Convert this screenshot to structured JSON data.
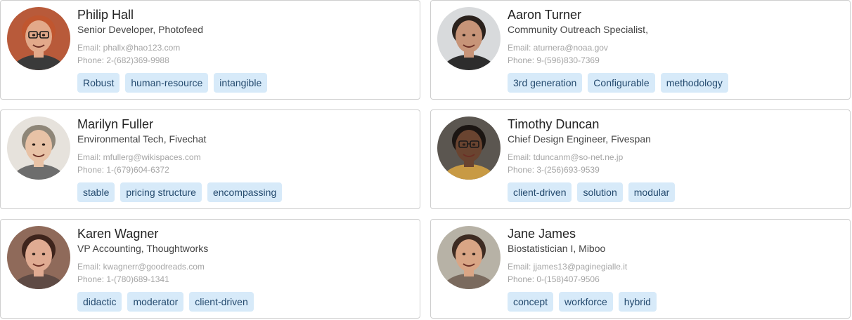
{
  "cards": [
    {
      "name": "Philip Hall",
      "title": "Senior Developer, Photofeed",
      "email": "Email: phallx@hao123.com",
      "phone": "Phone: 2-(682)369-9988",
      "tags": [
        "Robust",
        "human-resource",
        "intangible"
      ],
      "avatar": {
        "bg": "#b85a3a",
        "skin": "#e2a98a",
        "hair": "#c0562f",
        "shirt": "#3a3a3a",
        "glasses": true
      }
    },
    {
      "name": "Aaron Turner",
      "title": "Community Outreach Specialist,",
      "email": "Email: aturnera@noaa.gov",
      "phone": "Phone: 9-(596)830-7369",
      "tags": [
        "3rd generation",
        "Configurable",
        "methodology"
      ],
      "avatar": {
        "bg": "#d8dadc",
        "skin": "#c79478",
        "hair": "#2a211c",
        "shirt": "#2d2d2d",
        "glasses": false
      }
    },
    {
      "name": "Marilyn Fuller",
      "title": "Environmental Tech, Fivechat",
      "email": "Email: mfullerg@wikispaces.com",
      "phone": "Phone: 1-(679)604-6372",
      "tags": [
        "stable",
        "pricing structure",
        "encompassing"
      ],
      "avatar": {
        "bg": "#e6e2dc",
        "skin": "#e8c2a6",
        "hair": "#8e8678",
        "shirt": "#6d6d6d",
        "glasses": false
      }
    },
    {
      "name": "Timothy Duncan",
      "title": "Chief Design Engineer, Fivespan",
      "email": "Email: tduncanm@so-net.ne.jp",
      "phone": "Phone: 3-(256)693-9539",
      "tags": [
        "client-driven",
        "solution",
        "modular"
      ],
      "avatar": {
        "bg": "#5b5650",
        "skin": "#6a4430",
        "hair": "#1b1512",
        "shirt": "#c89a44",
        "glasses": true
      }
    },
    {
      "name": "Karen Wagner",
      "title": "VP Accounting, Thoughtworks",
      "email": "Email: kwagnerr@goodreads.com",
      "phone": "Phone: 1-(780)689-1341",
      "tags": [
        "didactic",
        "moderator",
        "client-driven"
      ],
      "avatar": {
        "bg": "#8f6a5a",
        "skin": "#e0ab92",
        "hair": "#3e241c",
        "shirt": "#5e4a44",
        "glasses": false
      }
    },
    {
      "name": "Jane James",
      "title": "Biostatistician I, Miboo",
      "email": "Email: jjames13@paginegialle.it",
      "phone": "Phone: 0-(158)407-9506",
      "tags": [
        "concept",
        "workforce",
        "hybrid"
      ],
      "avatar": {
        "bg": "#b7b2a6",
        "skin": "#d9a585",
        "hair": "#3d2b22",
        "shirt": "#7a6a5e",
        "glasses": false
      }
    }
  ]
}
